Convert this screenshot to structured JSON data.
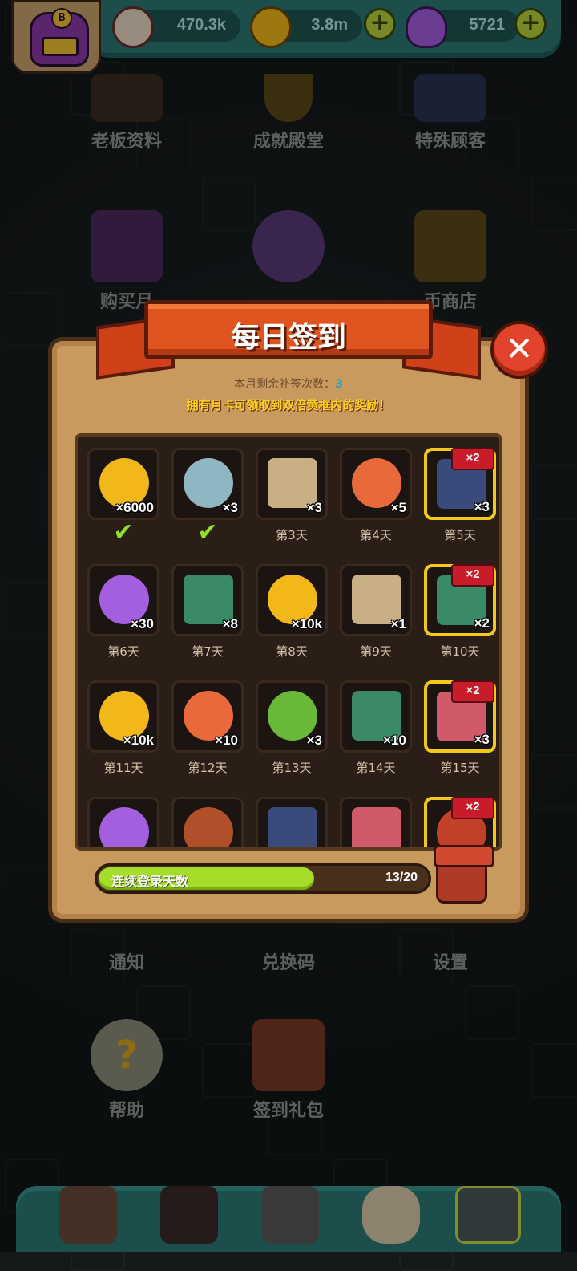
{
  "resources": [
    {
      "icon": "eyeball-icon",
      "value": "470.3k"
    },
    {
      "icon": "gold-coin-icon",
      "value": "3.8m",
      "plus": "+"
    },
    {
      "icon": "potion-icon",
      "value": "5721",
      "plus": "+"
    }
  ],
  "avatar": {
    "badge": "B"
  },
  "menu": {
    "row1": [
      "老板资料",
      "成就殿堂",
      "特殊顾客"
    ],
    "row2": [
      "购买月",
      "",
      "币商店"
    ],
    "row3": [
      "通知",
      "兑换码",
      "设置"
    ],
    "row4": [
      "帮助",
      "签到礼包"
    ]
  },
  "dialog": {
    "title": "每日签到",
    "close": "✕",
    "makeup_label": "本月剩余补签次数：",
    "makeup_count": "3",
    "hint": "拥有月卡可领取到双倍黄框内的奖励！",
    "streak_label": "连续登录天数",
    "streak_count": "13/20",
    "streak_progress": 0.65
  },
  "days": [
    {
      "label": "",
      "qty": "×6000",
      "icon": "gold-coin-icon",
      "claimed": true,
      "double": false
    },
    {
      "label": "",
      "qty": "×3",
      "icon": "orb-icon",
      "claimed": true,
      "double": false
    },
    {
      "label": "第3天",
      "qty": "×3",
      "icon": "map-scroll-icon",
      "claimed": false,
      "double": false
    },
    {
      "label": "第4天",
      "qty": "×5",
      "icon": "capsule-icon",
      "claimed": false,
      "double": false
    },
    {
      "label": "第5天",
      "qty": "×3",
      "icon": "card-pack-icon",
      "claimed": false,
      "double": true,
      "x2": "×2"
    },
    {
      "label": "第6天",
      "qty": "×30",
      "icon": "potion-icon",
      "claimed": false,
      "double": false
    },
    {
      "label": "第7天",
      "qty": "×8",
      "icon": "ticket-icon",
      "claimed": false,
      "double": false
    },
    {
      "label": "第8天",
      "qty": "×10k",
      "icon": "gold-coin-icon",
      "claimed": false,
      "double": false
    },
    {
      "label": "第9天",
      "qty": "×1",
      "icon": "coupon-icon",
      "claimed": false,
      "double": false
    },
    {
      "label": "第10天",
      "qty": "×2",
      "icon": "monster-card-icon",
      "claimed": false,
      "double": true,
      "x2": "×2"
    },
    {
      "label": "第11天",
      "qty": "×10k",
      "icon": "gold-coin-icon",
      "claimed": false,
      "double": false
    },
    {
      "label": "第12天",
      "qty": "×10",
      "icon": "capsule-icon",
      "claimed": false,
      "double": false
    },
    {
      "label": "第13天",
      "qty": "×3",
      "icon": "slime-icon",
      "claimed": false,
      "double": false
    },
    {
      "label": "第14天",
      "qty": "×10",
      "icon": "ticket-icon",
      "claimed": false,
      "double": false
    },
    {
      "label": "第15天",
      "qty": "×3",
      "icon": "fabric-icon",
      "claimed": false,
      "double": true,
      "x2": "×2"
    },
    {
      "label": "",
      "qty": "",
      "icon": "potion-icon",
      "claimed": false,
      "double": false
    },
    {
      "label": "",
      "qty": "",
      "icon": "feather-icon",
      "claimed": false,
      "double": false
    },
    {
      "label": "",
      "qty": "",
      "icon": "card-pack-icon",
      "claimed": false,
      "double": false
    },
    {
      "label": "",
      "qty": "",
      "icon": "fabric-icon",
      "claimed": false,
      "double": false
    },
    {
      "label": "",
      "qty": "",
      "icon": "gift-icon",
      "claimed": false,
      "double": true,
      "x2": "×2"
    }
  ],
  "colors": {
    "coin": "#f2b81a",
    "orb": "#8fb7c2",
    "potion": "#a45ee0",
    "capsule": "#e86a3a",
    "scroll": "#c8b084",
    "ticket": "#3a8a68",
    "slime": "#6ab83a",
    "fabric": "#d05a6a",
    "card": "#3a4a7a",
    "feather": "#b0502a",
    "gift": "#c0402a"
  },
  "nav": [
    "shop-icon",
    "monster-icon",
    "book-icon",
    "bag-icon",
    "grid-menu-icon"
  ]
}
